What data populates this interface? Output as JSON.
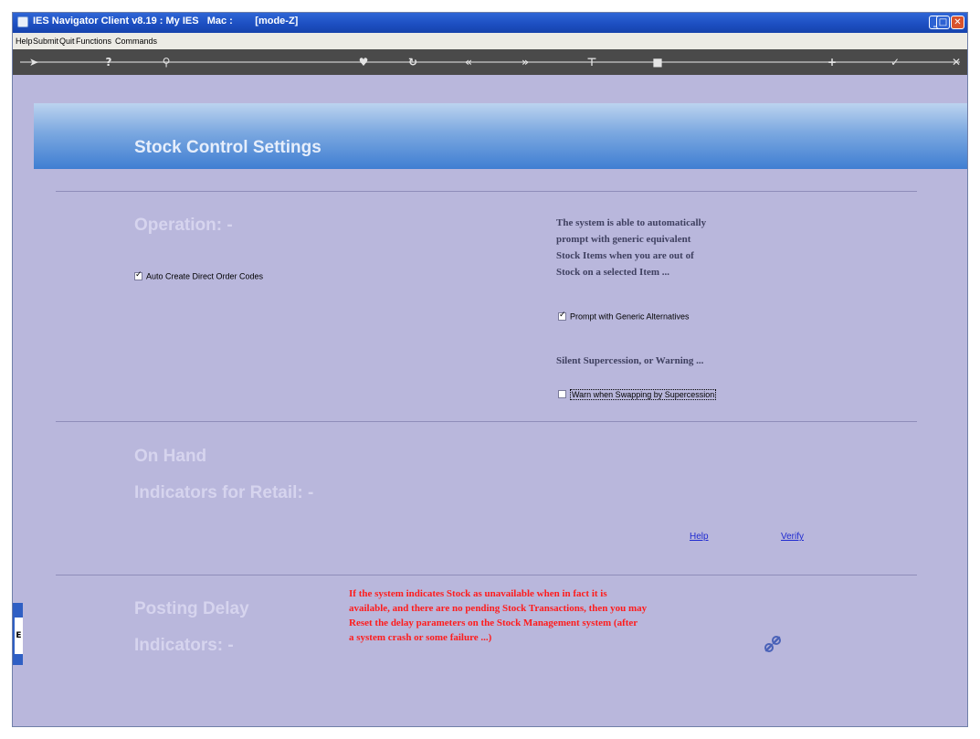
{
  "window": {
    "title": "IES Navigator Client v8.19 : My IES   Mac :        [mode-Z]"
  },
  "menu": {
    "items": [
      "Help",
      "Submit",
      "Quit",
      "Functions",
      "Commands"
    ]
  },
  "toolbar": {
    "icons": [
      "arrow-icon",
      "help-icon",
      "search-icon",
      "heart-icon",
      "refresh-icon",
      "back-icon",
      "forward-icon",
      "pin-icon",
      "stop-icon",
      "plus-icon",
      "check-icon",
      "close-icon"
    ]
  },
  "page": {
    "title": "Stock Control Settings"
  },
  "operation": {
    "heading": "Operation: -",
    "auto_create_label": "Auto Create Direct Order Codes",
    "auto_create_checked": true
  },
  "generic": {
    "info_lines": [
      "The system is able to automatically",
      "prompt with generic equivalent",
      "Stock Items when you are out of",
      "Stock on a selected Item ..."
    ],
    "prompt_label": "Prompt with Generic Alternatives",
    "prompt_checked": true
  },
  "supercession": {
    "heading": "Silent Supercession, or Warning ...",
    "warn_label": "Warn when Swapping by Supercession",
    "warn_checked": false
  },
  "onhand": {
    "heading_line1": "On Hand",
    "heading_line2": "Indicators for Retail: -",
    "help_link": "Help",
    "verify_link": "Verify"
  },
  "posting": {
    "heading_line1": "Posting Delay",
    "heading_line2": "Indicators: -",
    "warning_lines": [
      "If the system indicates Stock as   unavailable when in fact it is",
      "available, and there are no pending Stock Transactions, then you may",
      "Reset the delay parameters on the  Stock Management system (after",
      "a system crash or some failure ...)"
    ]
  },
  "colors": {
    "background": "#b9b7dc",
    "banner": "#3f7ed2",
    "warning": "#ff1c1c",
    "link": "#1f2ad0"
  }
}
